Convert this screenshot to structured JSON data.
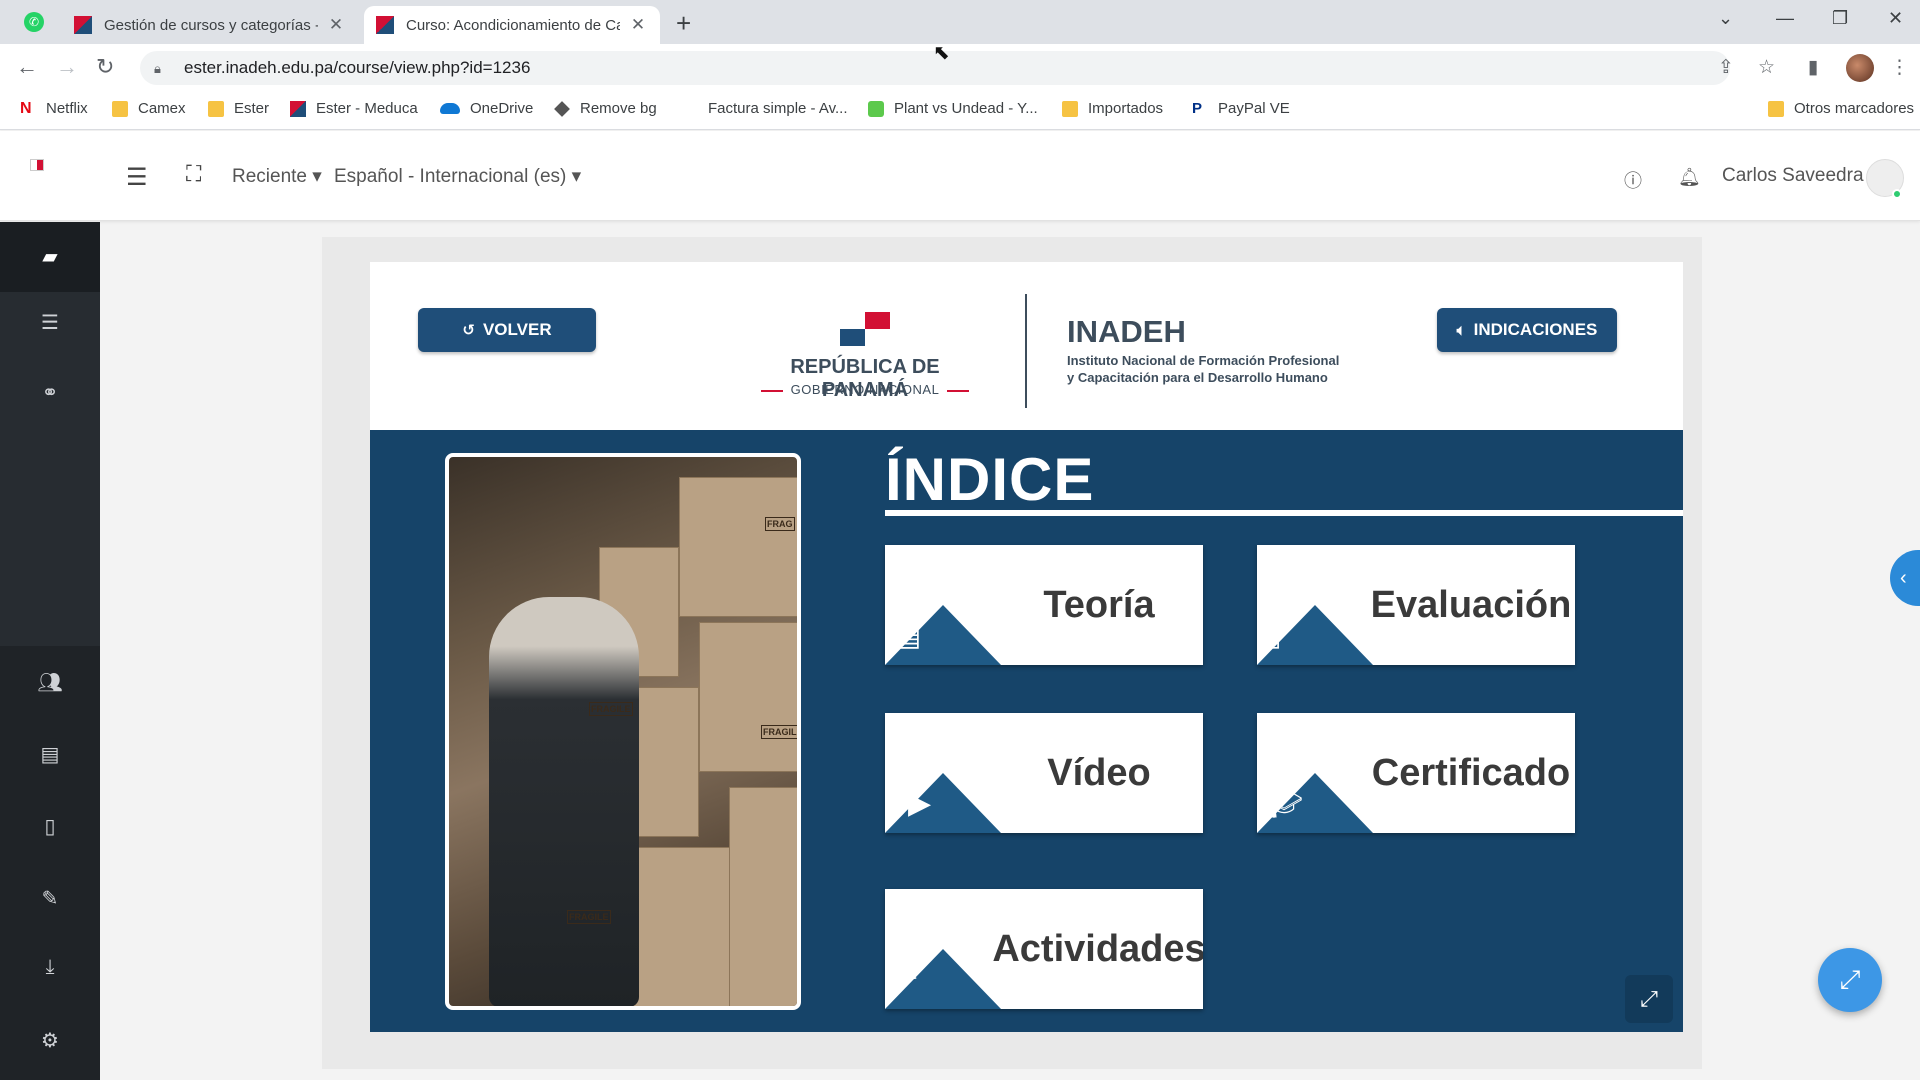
{
  "browser": {
    "tabs": [
      {
        "title": "Gestión de cursos y categorías -",
        "active": false
      },
      {
        "title": "Curso: Acondicionamiento de Ca",
        "active": true
      }
    ],
    "url": "ester.inadeh.edu.pa/course/view.php?id=1236",
    "bookmarks": [
      "Netflix",
      "Camex",
      "Ester",
      "Ester - Meduca",
      "OneDrive",
      "Remove bg",
      "Factura simple - Av...",
      "Plant vs Undead - Y...",
      "Importados",
      "PayPal VE"
    ],
    "other_bookmarks": "Otros marcadores"
  },
  "header": {
    "recent_label": "Reciente",
    "language_label": "Español - Internacional (es)",
    "user_name": "Carlos Saveedra"
  },
  "slide": {
    "back_button": "VOLVER",
    "indications_button": "INDICACIONES",
    "republic_title": "REPÚBLICA DE PANAMÁ",
    "republic_sub": "GOBIERNO NACIONAL",
    "inadeh_title": "INADEH",
    "inadeh_line1": "Instituto Nacional de Formación Profesional",
    "inadeh_line2": "y Capacitación para el Desarrollo Humano",
    "index_title": "ÍNDICE",
    "cards": {
      "teoria": "Teoría",
      "evaluacion": "Evaluación",
      "video": "Vídeo",
      "certificado": "Certificado",
      "actividades": "Actividades"
    },
    "box_labels": [
      "FRAGILE",
      "FRAGILE",
      "FRAGILE",
      "FRAG"
    ]
  },
  "colors": {
    "slide_blue": "#164469",
    "button_blue": "#1f4e79",
    "fab_blue": "#3d97e6"
  }
}
